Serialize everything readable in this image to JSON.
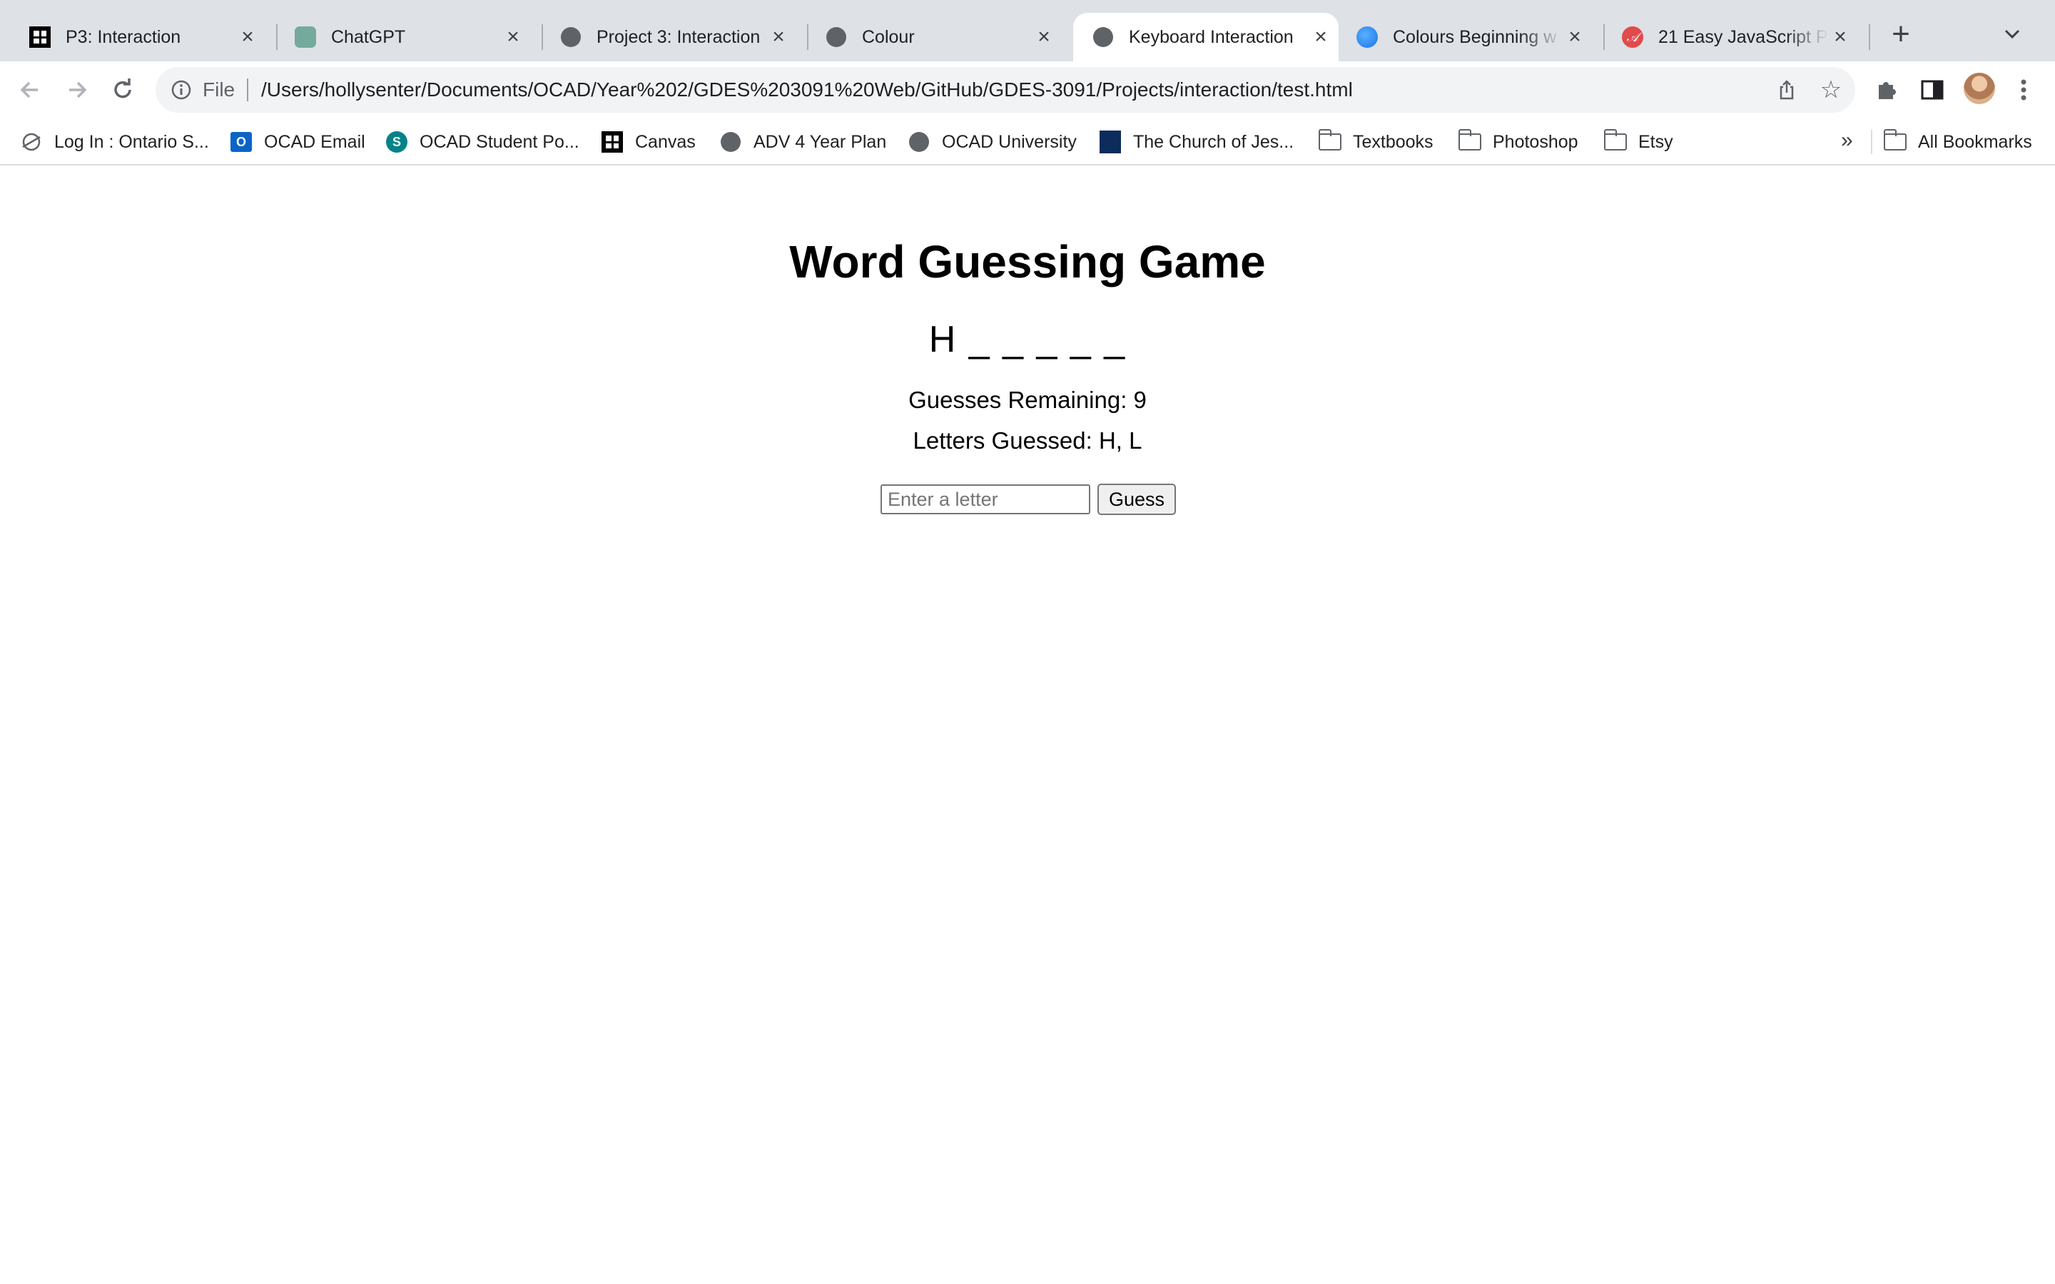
{
  "browser": {
    "tabs": [
      {
        "title": "P3: Interaction",
        "favicon": "canvas-icon",
        "active": false
      },
      {
        "title": "ChatGPT",
        "favicon": "chatgpt-icon",
        "active": false
      },
      {
        "title": "Project 3: Interaction",
        "favicon": "globe-icon",
        "active": false
      },
      {
        "title": "Colour",
        "favicon": "globe-icon",
        "active": false
      },
      {
        "title": "Keyboard Interaction",
        "favicon": "globe-icon",
        "active": true
      },
      {
        "title": "Colours Beginning w",
        "favicon": "colours-site-icon",
        "active": false
      },
      {
        "title": "21 Easy JavaScript P",
        "favicon": "js-site-icon",
        "active": false
      }
    ],
    "address_bar": {
      "scheme_label": "File",
      "url": "/Users/hollysenter/Documents/OCAD/Year%202/GDES%203091%20Web/GitHub/GDES-3091/Projects/interaction/test.html"
    },
    "bookmarks": [
      {
        "label": "Log In : Ontario S...",
        "icon": "ontario-icon"
      },
      {
        "label": "OCAD Email",
        "icon": "outlook-icon"
      },
      {
        "label": "OCAD Student Po...",
        "icon": "sharepoint-icon"
      },
      {
        "label": "Canvas",
        "icon": "canvas-icon"
      },
      {
        "label": "ADV 4 Year Plan",
        "icon": "globe-icon"
      },
      {
        "label": "OCAD University",
        "icon": "globe-icon"
      },
      {
        "label": "The Church of Jes...",
        "icon": "church-icon"
      },
      {
        "label": "Textbooks",
        "icon": "folder-icon"
      },
      {
        "label": "Photoshop",
        "icon": "folder-icon"
      },
      {
        "label": "Etsy",
        "icon": "folder-icon"
      }
    ],
    "bookmarks_overflow": "»",
    "all_bookmarks_label": "All Bookmarks"
  },
  "game": {
    "title": "Word Guessing Game",
    "word_display": "H _ _ _ _ _",
    "guesses_remaining": "Guesses Remaining: 9",
    "letters_guessed": "Letters Guessed: H, L",
    "input_placeholder": "Enter a letter",
    "input_value": "",
    "guess_button_label": "Guess"
  },
  "colors": {
    "tabstrip_bg": "#dee1e6",
    "omnibox_bg": "#f1f3f4",
    "page_bg": "#ffffff",
    "text": "#000000"
  }
}
